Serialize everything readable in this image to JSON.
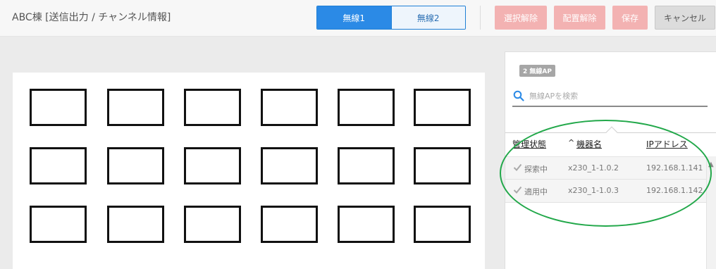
{
  "header": {
    "title": "ABC棟 [送信出力 / チャンネル情報]",
    "tabs": [
      {
        "label": "無線1",
        "active": true
      },
      {
        "label": "無線2",
        "active": false
      }
    ],
    "buttons": {
      "deselect": "選択解除",
      "unplace": "配置解除",
      "save": "保存",
      "cancel": "キャンセル"
    }
  },
  "panel": {
    "badge": "2 無線AP",
    "search_placeholder": "無線APを検索",
    "columns": {
      "status": "管理状態",
      "sort_indicator": "^",
      "device_name": "機器名",
      "ip_address": "IPアドレス"
    },
    "rows": [
      {
        "status": "探索中",
        "device_name": "x230_1-1.0.2",
        "ip_address": "192.168.1.141"
      },
      {
        "status": "適用中",
        "device_name": "x230_1-1.0.3",
        "ip_address": "192.168.1.142"
      }
    ]
  },
  "floor_map": {
    "ap_slot_rows": 3,
    "ap_slot_cols": 6
  },
  "colors": {
    "accent": "#2b8ae6",
    "disabled_action": "#f3b2b2",
    "highlight": "#22a84a"
  }
}
